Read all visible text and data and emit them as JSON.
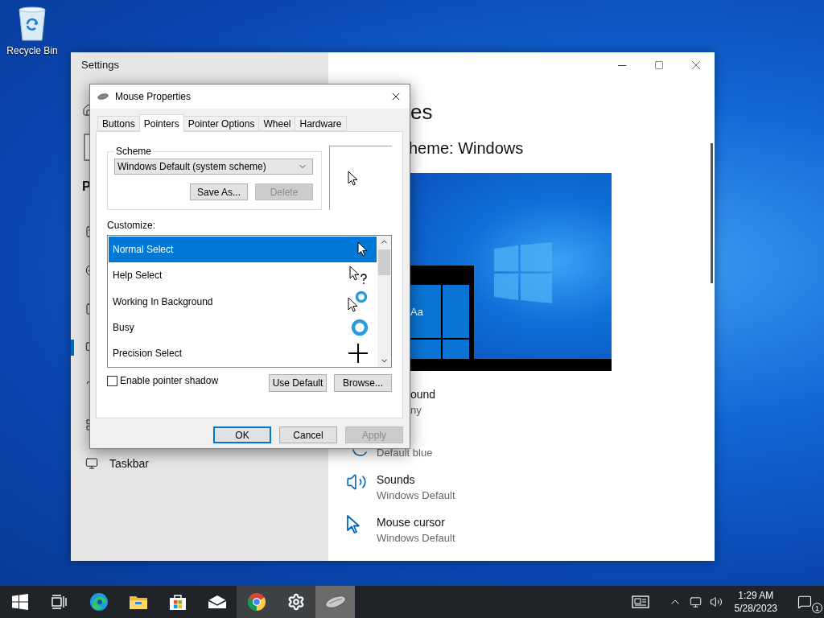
{
  "desktop": {
    "icons": [
      {
        "label": "Recycle Bin"
      }
    ]
  },
  "settings": {
    "title": "Settings",
    "nav_heading": "P",
    "nav_items": [
      {
        "selected": false
      },
      {
        "selected": false
      },
      {
        "selected": false
      },
      {
        "selected": true
      },
      {
        "selected": false
      },
      {
        "selected": false
      },
      {
        "label": "Taskbar",
        "selected": false
      }
    ],
    "heading": "es",
    "subheading": "heme: Windows",
    "preview": {
      "sample_text": "Aa"
    },
    "items": [
      {
        "kind": "clipped",
        "title": "ound",
        "subtitle": "ny"
      },
      {
        "kind": "color",
        "subtitle": "Default blue"
      },
      {
        "kind": "sounds",
        "title": "Sounds",
        "subtitle": "Windows Default"
      },
      {
        "kind": "cursor",
        "title": "Mouse cursor",
        "subtitle": "Windows Default"
      }
    ]
  },
  "dialog": {
    "title": "Mouse Properties",
    "tabs": [
      {
        "label": "Buttons",
        "selected": false
      },
      {
        "label": "Pointers",
        "selected": true
      },
      {
        "label": "Pointer Options",
        "selected": false
      },
      {
        "label": "Wheel",
        "selected": false
      },
      {
        "label": "Hardware",
        "selected": false
      }
    ],
    "scheme": {
      "label": "Scheme",
      "value": "Windows Default (system scheme)",
      "buttons": [
        {
          "label": "Save As...",
          "disabled": false
        },
        {
          "label": "Delete",
          "disabled": true
        }
      ]
    },
    "customize": {
      "label": "Customize:",
      "rows": [
        {
          "label": "Normal Select",
          "kind": "arrow",
          "selected": true
        },
        {
          "label": "Help Select",
          "kind": "help",
          "selected": false
        },
        {
          "label": "Working In Background",
          "kind": "working",
          "selected": false
        },
        {
          "label": "Busy",
          "kind": "busy",
          "selected": false
        },
        {
          "label": "Precision Select",
          "kind": "cross",
          "selected": false
        }
      ]
    },
    "pointer_shadow": {
      "label": "Enable pointer shadow",
      "checked": false
    },
    "list_buttons": [
      {
        "label": "Use Default",
        "disabled": false
      },
      {
        "label": "Browse...",
        "disabled": false
      }
    ],
    "footer_buttons": [
      {
        "label": "OK",
        "disabled": false,
        "default": true
      },
      {
        "label": "Cancel",
        "disabled": false,
        "default": false
      },
      {
        "label": "Apply",
        "disabled": true,
        "default": false
      }
    ]
  },
  "taskbar": {
    "apps": [
      {
        "open": false,
        "selected": false
      },
      {
        "open": false,
        "selected": false
      },
      {
        "open": false,
        "selected": false
      },
      {
        "open": false,
        "selected": false
      },
      {
        "open": false,
        "selected": false
      },
      {
        "open": false,
        "selected": false
      },
      {
        "open": true,
        "selected": false
      },
      {
        "open": true,
        "selected": false
      },
      {
        "open": true,
        "selected": true
      }
    ],
    "clock": {
      "time": "1:29 AM",
      "date": "5/28/2023"
    },
    "notifications": {
      "badge": "1"
    }
  }
}
